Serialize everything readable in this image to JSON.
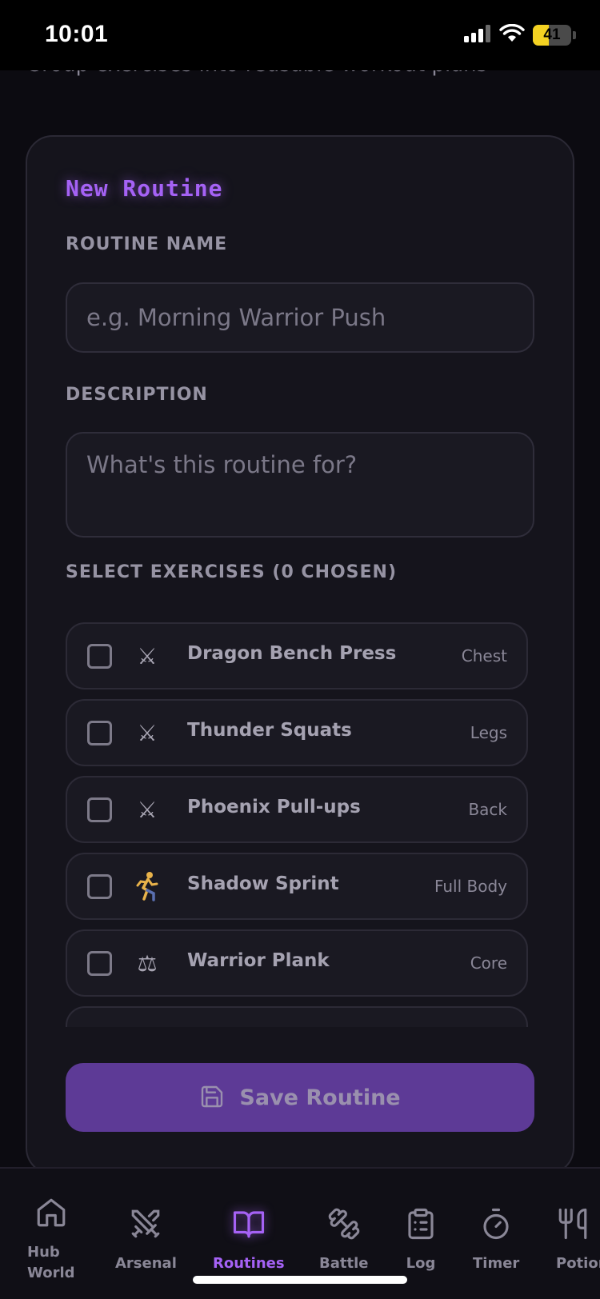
{
  "status_bar": {
    "time": "10:01",
    "battery": "41"
  },
  "page": {
    "subtitle": "Group exercises into reusable workout plans"
  },
  "form": {
    "title": "New Routine",
    "routine_name_label": "ROUTINE NAME",
    "routine_name_placeholder": "e.g. Morning Warrior Push",
    "routine_name_value": "",
    "description_label": "DESCRIPTION",
    "description_placeholder": "What's this routine for?",
    "description_value": "",
    "exercises_label": "SELECT EXERCISES (0 CHOSEN)",
    "exercises": [
      {
        "icon": "crossed-swords-icon",
        "name": "Dragon Bench Press",
        "category": "Chest",
        "checked": false
      },
      {
        "icon": "crossed-swords-icon",
        "name": "Thunder Squats",
        "category": "Legs",
        "checked": false
      },
      {
        "icon": "crossed-swords-icon",
        "name": "Phoenix Pull-ups",
        "category": "Back",
        "checked": false
      },
      {
        "icon": "runner-icon",
        "name": "Shadow Sprint",
        "category": "Full Body",
        "checked": false
      },
      {
        "icon": "scales-icon",
        "name": "Warrior Plank",
        "category": "Core",
        "checked": false
      },
      {
        "icon": "crossed-swords-icon",
        "name": "",
        "category": "",
        "checked": false
      }
    ],
    "save_label": "Save Routine"
  },
  "nav": {
    "items": [
      {
        "label": "Hub World",
        "icon": "home-icon",
        "active": false
      },
      {
        "label": "Arsenal",
        "icon": "swords-icon",
        "active": false
      },
      {
        "label": "Routines",
        "icon": "book-open-icon",
        "active": true
      },
      {
        "label": "Battle",
        "icon": "dumbbell-icon",
        "active": false
      },
      {
        "label": "Log",
        "icon": "clipboard-icon",
        "active": false
      },
      {
        "label": "Timer",
        "icon": "timer-icon",
        "active": false
      },
      {
        "label": "Potion",
        "icon": "utensils-icon",
        "active": false
      }
    ]
  },
  "colors": {
    "accent": "#a562f5",
    "button": "#5d3a96",
    "background": "#0c0b11",
    "card": "#15141c"
  }
}
